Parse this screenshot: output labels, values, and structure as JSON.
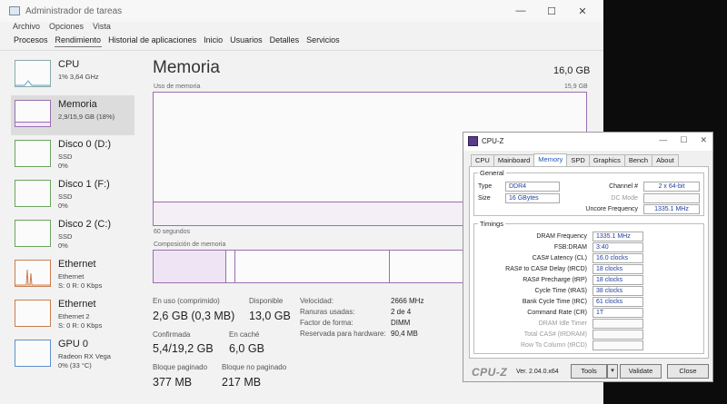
{
  "task_manager": {
    "window_title": "Administrador de tareas",
    "window_controls": {
      "minimize": "—",
      "maximize": "☐",
      "close": "✕"
    },
    "menu": [
      "Archivo",
      "Opciones",
      "Vista"
    ],
    "tabs": [
      "Procesos",
      "Rendimiento",
      "Historial de aplicaciones",
      "Inicio",
      "Usuarios",
      "Detalles",
      "Servicios"
    ],
    "active_tab": "Rendimiento",
    "sidebar": {
      "items": [
        {
          "name": "CPU",
          "sub1": "1% 3,64 GHz",
          "sub2": ""
        },
        {
          "name": "Memoria",
          "sub1": "2,9/15,9 GB (18%)",
          "sub2": ""
        },
        {
          "name": "Disco 0 (D:)",
          "sub1": "SSD",
          "sub2": "0%"
        },
        {
          "name": "Disco 1 (F:)",
          "sub1": "SSD",
          "sub2": "0%"
        },
        {
          "name": "Disco 2 (C:)",
          "sub1": "SSD",
          "sub2": "0%"
        },
        {
          "name": "Ethernet",
          "sub1": "Ethernet",
          "sub2": "S: 0 R: 0 Kbps"
        },
        {
          "name": "Ethernet",
          "sub1": "Ethernet 2",
          "sub2": "S: 0 R: 0 Kbps"
        },
        {
          "name": "GPU 0",
          "sub1": "Radeon RX Vega",
          "sub2": "0% (33 °C)"
        }
      ]
    },
    "memory": {
      "title": "Memoria",
      "total": "16,0 GB",
      "usage_label": "Uso de memoria",
      "usage_max": "15,9 GB",
      "usage_fraction": 0.18,
      "seconds_label": "60 segundos",
      "composition_label": "Composición de memoria",
      "stats": {
        "in_use_label": "En uso (comprimido)",
        "in_use_value": "2,6 GB (0,3 MB)",
        "available_label": "Disponible",
        "available_value": "13,0 GB",
        "committed_label": "Confirmada",
        "committed_value": "5,4/19,2 GB",
        "cached_label": "En caché",
        "cached_value": "6,0 GB",
        "paged_label": "Bloque paginado",
        "paged_value": "377 MB",
        "nonpaged_label": "Bloque no paginado",
        "nonpaged_value": "217 MB"
      },
      "details": {
        "speed_label": "Velocidad:",
        "speed_value": "2666 MHz",
        "slots_label": "Ranuras usadas:",
        "slots_value": "2 de 4",
        "form_label": "Factor de forma:",
        "form_value": "DIMM",
        "reserved_label": "Reservada para hardware:",
        "reserved_value": "90,4 MB"
      }
    }
  },
  "cpuz": {
    "window_title": "CPU-Z",
    "window_controls": {
      "minimize": "—",
      "maximize": "☐",
      "close": "✕"
    },
    "tabs": [
      "CPU",
      "Mainboard",
      "Memory",
      "SPD",
      "Graphics",
      "Bench",
      "About"
    ],
    "active_tab": "Memory",
    "general": {
      "title": "General",
      "type_label": "Type",
      "type_value": "DDR4",
      "size_label": "Size",
      "size_value": "16 GBytes",
      "channel_label": "Channel #",
      "channel_value": "2 x 64-bit",
      "dc_mode_label": "DC Mode",
      "uncore_label": "Uncore Frequency",
      "uncore_value": "1335.1 MHz"
    },
    "timings": {
      "title": "Timings",
      "rows": [
        {
          "label": "DRAM Frequency",
          "value": "1335.1 MHz",
          "dim": false
        },
        {
          "label": "FSB:DRAM",
          "value": "3:40",
          "dim": false
        },
        {
          "label": "CAS# Latency (CL)",
          "value": "16.0 clocks",
          "dim": false
        },
        {
          "label": "RAS# to CAS# Delay (tRCD)",
          "value": "18 clocks",
          "dim": false
        },
        {
          "label": "RAS# Precharge (tRP)",
          "value": "18 clocks",
          "dim": false
        },
        {
          "label": "Cycle Time (tRAS)",
          "value": "38 clocks",
          "dim": false
        },
        {
          "label": "Bank Cycle Time (tRC)",
          "value": "61 clocks",
          "dim": false
        },
        {
          "label": "Command Rate (CR)",
          "value": "1T",
          "dim": false
        },
        {
          "label": "DRAM Idle Timer",
          "value": "",
          "dim": true
        },
        {
          "label": "Total CAS# (tRDRAM)",
          "value": "",
          "dim": true
        },
        {
          "label": "Row To Column (tRCD)",
          "value": "",
          "dim": true
        }
      ]
    },
    "footer": {
      "logo": "CPU-Z",
      "version": "Ver. 2.04.0.x64",
      "tools_label": "Tools",
      "tools_arrow": "▾",
      "validate_label": "Validate",
      "close_label": "Close"
    }
  }
}
